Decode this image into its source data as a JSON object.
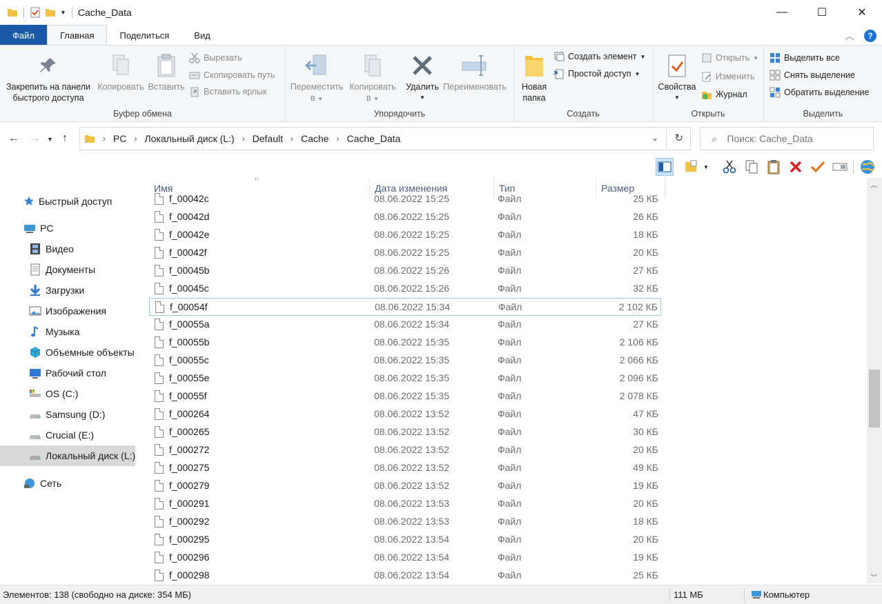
{
  "window": {
    "title": "Cache_Data",
    "minimize": "—",
    "maximize": "☐",
    "close": "✕"
  },
  "ribbon_tabs": [
    "Файл",
    "Главная",
    "Поделиться",
    "Вид"
  ],
  "ribbon": {
    "clipboard": {
      "label": "Буфер обмена",
      "pin": "Закрепить на панели быстрого доступа",
      "pin_line1": "Закрепить на панели",
      "pin_line2": "быстрого доступа",
      "copy": "Копировать",
      "paste": "Вставить",
      "cut": "Вырезать",
      "copy_path": "Скопировать путь",
      "paste_shortcut": "Вставить ярлык"
    },
    "organize": {
      "label": "Упорядочить",
      "move_line1": "Переместить",
      "move_line2": "в",
      "copy_line1": "Копировать",
      "copy_line2": "в",
      "delete": "Удалить",
      "rename": "Переименовать"
    },
    "new": {
      "label": "Создать",
      "folder_line1": "Новая",
      "folder_line2": "папка",
      "new_item": "Создать элемент",
      "easy_access": "Простой доступ"
    },
    "open": {
      "label": "Открыть",
      "properties": "Свойства",
      "open": "Открыть",
      "edit": "Изменить",
      "history": "Журнал"
    },
    "select": {
      "label": "Выделить",
      "select_all": "Выделить все",
      "select_none": "Снять выделение",
      "invert": "Обратить выделение"
    }
  },
  "address": {
    "crumbs": [
      "PC",
      "Локальный диск (L:)",
      "Default",
      "Cache",
      "Cache_Data"
    ],
    "search_placeholder": "Поиск: Cache_Data"
  },
  "nav": [
    {
      "label": "Быстрый доступ",
      "icon": "star-icon"
    },
    {
      "label": "PC",
      "icon": "pc-icon"
    },
    {
      "label": "Видео",
      "icon": "video-icon"
    },
    {
      "label": "Документы",
      "icon": "documents-icon"
    },
    {
      "label": "Загрузки",
      "icon": "downloads-icon"
    },
    {
      "label": "Изображения",
      "icon": "pictures-icon"
    },
    {
      "label": "Музыка",
      "icon": "music-icon"
    },
    {
      "label": "Объемные объекты",
      "icon": "3d-objects-icon"
    },
    {
      "label": "Рабочий стол",
      "icon": "desktop-icon"
    },
    {
      "label": "OS (C:)",
      "icon": "drive-os-icon"
    },
    {
      "label": "Samsung (D:)",
      "icon": "drive-icon"
    },
    {
      "label": "Crucial (E:)",
      "icon": "drive-icon"
    },
    {
      "label": "Локальный диск (L:)",
      "icon": "drive-icon"
    },
    {
      "label": "Сеть",
      "icon": "network-icon"
    }
  ],
  "columns": {
    "name": "Имя",
    "date": "Дата изменения",
    "type": "Тип",
    "size": "Размер"
  },
  "files": [
    {
      "name": "f_00042c",
      "date": "08.06.2022 15:25",
      "type": "Файл",
      "size": "25 КБ"
    },
    {
      "name": "f_00042d",
      "date": "08.06.2022 15:25",
      "type": "Файл",
      "size": "26 КБ"
    },
    {
      "name": "f_00042e",
      "date": "08.06.2022 15:25",
      "type": "Файл",
      "size": "18 КБ"
    },
    {
      "name": "f_00042f",
      "date": "08.06.2022 15:25",
      "type": "Файл",
      "size": "20 КБ"
    },
    {
      "name": "f_00045b",
      "date": "08.06.2022 15:26",
      "type": "Файл",
      "size": "27 КБ"
    },
    {
      "name": "f_00045c",
      "date": "08.06.2022 15:26",
      "type": "Файл",
      "size": "32 КБ"
    },
    {
      "name": "f_00054f",
      "date": "08.06.2022 15:34",
      "type": "Файл",
      "size": "2 102 КБ"
    },
    {
      "name": "f_00055a",
      "date": "08.06.2022 15:34",
      "type": "Файл",
      "size": "27 КБ"
    },
    {
      "name": "f_00055b",
      "date": "08.06.2022 15:35",
      "type": "Файл",
      "size": "2 106 КБ"
    },
    {
      "name": "f_00055c",
      "date": "08.06.2022 15:35",
      "type": "Файл",
      "size": "2 066 КБ"
    },
    {
      "name": "f_00055e",
      "date": "08.06.2022 15:35",
      "type": "Файл",
      "size": "2 096 КБ"
    },
    {
      "name": "f_00055f",
      "date": "08.06.2022 15:35",
      "type": "Файл",
      "size": "2 078 КБ"
    },
    {
      "name": "f_000264",
      "date": "08.06.2022 13:52",
      "type": "Файл",
      "size": "47 КБ"
    },
    {
      "name": "f_000265",
      "date": "08.06.2022 13:52",
      "type": "Файл",
      "size": "30 КБ"
    },
    {
      "name": "f_000272",
      "date": "08.06.2022 13:52",
      "type": "Файл",
      "size": "20 КБ"
    },
    {
      "name": "f_000275",
      "date": "08.06.2022 13:52",
      "type": "Файл",
      "size": "49 КБ"
    },
    {
      "name": "f_000279",
      "date": "08.06.2022 13:52",
      "type": "Файл",
      "size": "19 КБ"
    },
    {
      "name": "f_000291",
      "date": "08.06.2022 13:53",
      "type": "Файл",
      "size": "20 КБ"
    },
    {
      "name": "f_000292",
      "date": "08.06.2022 13:53",
      "type": "Файл",
      "size": "18 КБ"
    },
    {
      "name": "f_000295",
      "date": "08.06.2022 13:54",
      "type": "Файл",
      "size": "20 КБ"
    },
    {
      "name": "f_000296",
      "date": "08.06.2022 13:54",
      "type": "Файл",
      "size": "19 КБ"
    },
    {
      "name": "f_000298",
      "date": "08.06.2022 13:54",
      "type": "Файл",
      "size": "25 КБ"
    }
  ],
  "status": {
    "items": "Элементов: 138 (свободно на диске: 354 МБ)",
    "size": "111 МБ",
    "computer": "Компьютер"
  },
  "colors": {
    "accent": "#1b5aa6",
    "folder": "#f4c03f",
    "selection_border": "#99c9ef"
  }
}
